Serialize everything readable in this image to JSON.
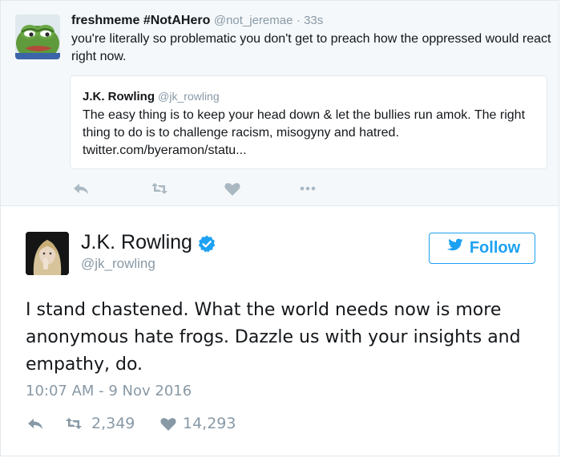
{
  "reply_tweet": {
    "display_name": "freshmeme #NotAHero",
    "handle": "@not_jeremae",
    "time": "· 33s",
    "text": "you're literally so problematic you don't get to preach how the oppressed would react right now.",
    "avatar_icon": "frog-avatar-icon",
    "quoted": {
      "display_name": "J.K. Rowling",
      "handle": "@jk_rowling",
      "text": "The easy thing is to keep your head down & let the bullies run amok. The right thing to do is to challenge racism, misogyny and hatred. twitter.com/byeramon/statu..."
    },
    "actions": [
      "reply-icon",
      "retweet-icon",
      "like-icon",
      "more-icon"
    ]
  },
  "main_tweet": {
    "display_name": "J.K. Rowling",
    "handle": "@jk_rowling",
    "verified_icon": "verified-badge-icon",
    "follow_label": "Follow",
    "text": "I stand chastened. What the world needs now is more anonymous hate frogs. Dazzle us with your insights and empathy, do.",
    "timestamp": "10:07 AM - 9 Nov 2016",
    "retweets": "2,349",
    "likes": "14,293"
  },
  "colors": {
    "accent": "#1da1f2",
    "muted": "#8899a6",
    "text": "#14171a",
    "reply_bg": "#f5f8fa",
    "border": "#e1e8ed"
  }
}
